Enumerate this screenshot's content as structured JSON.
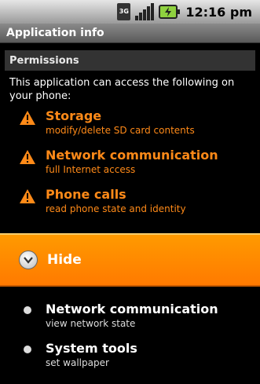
{
  "status_bar": {
    "network": "3G",
    "time": "12:16 pm"
  },
  "header": {
    "title": "Application info"
  },
  "section": {
    "title": "Permissions"
  },
  "intro_text": "This application can access the following on your phone:",
  "dangerous_permissions": [
    {
      "title": "Storage",
      "desc": "modify/delete SD card contents"
    },
    {
      "title": "Network communication",
      "desc": "full Internet access"
    },
    {
      "title": "Phone calls",
      "desc": "read phone state and identity"
    }
  ],
  "hide_button": {
    "label": "Hide"
  },
  "normal_permissions": [
    {
      "title": "Network communication",
      "desc": "view network state"
    },
    {
      "title": "System tools",
      "desc": "set wallpaper"
    }
  ],
  "colors": {
    "accent": "#ff8a18",
    "hide_bg": "#ff8a00",
    "title_bar": "#6f6f6f"
  }
}
